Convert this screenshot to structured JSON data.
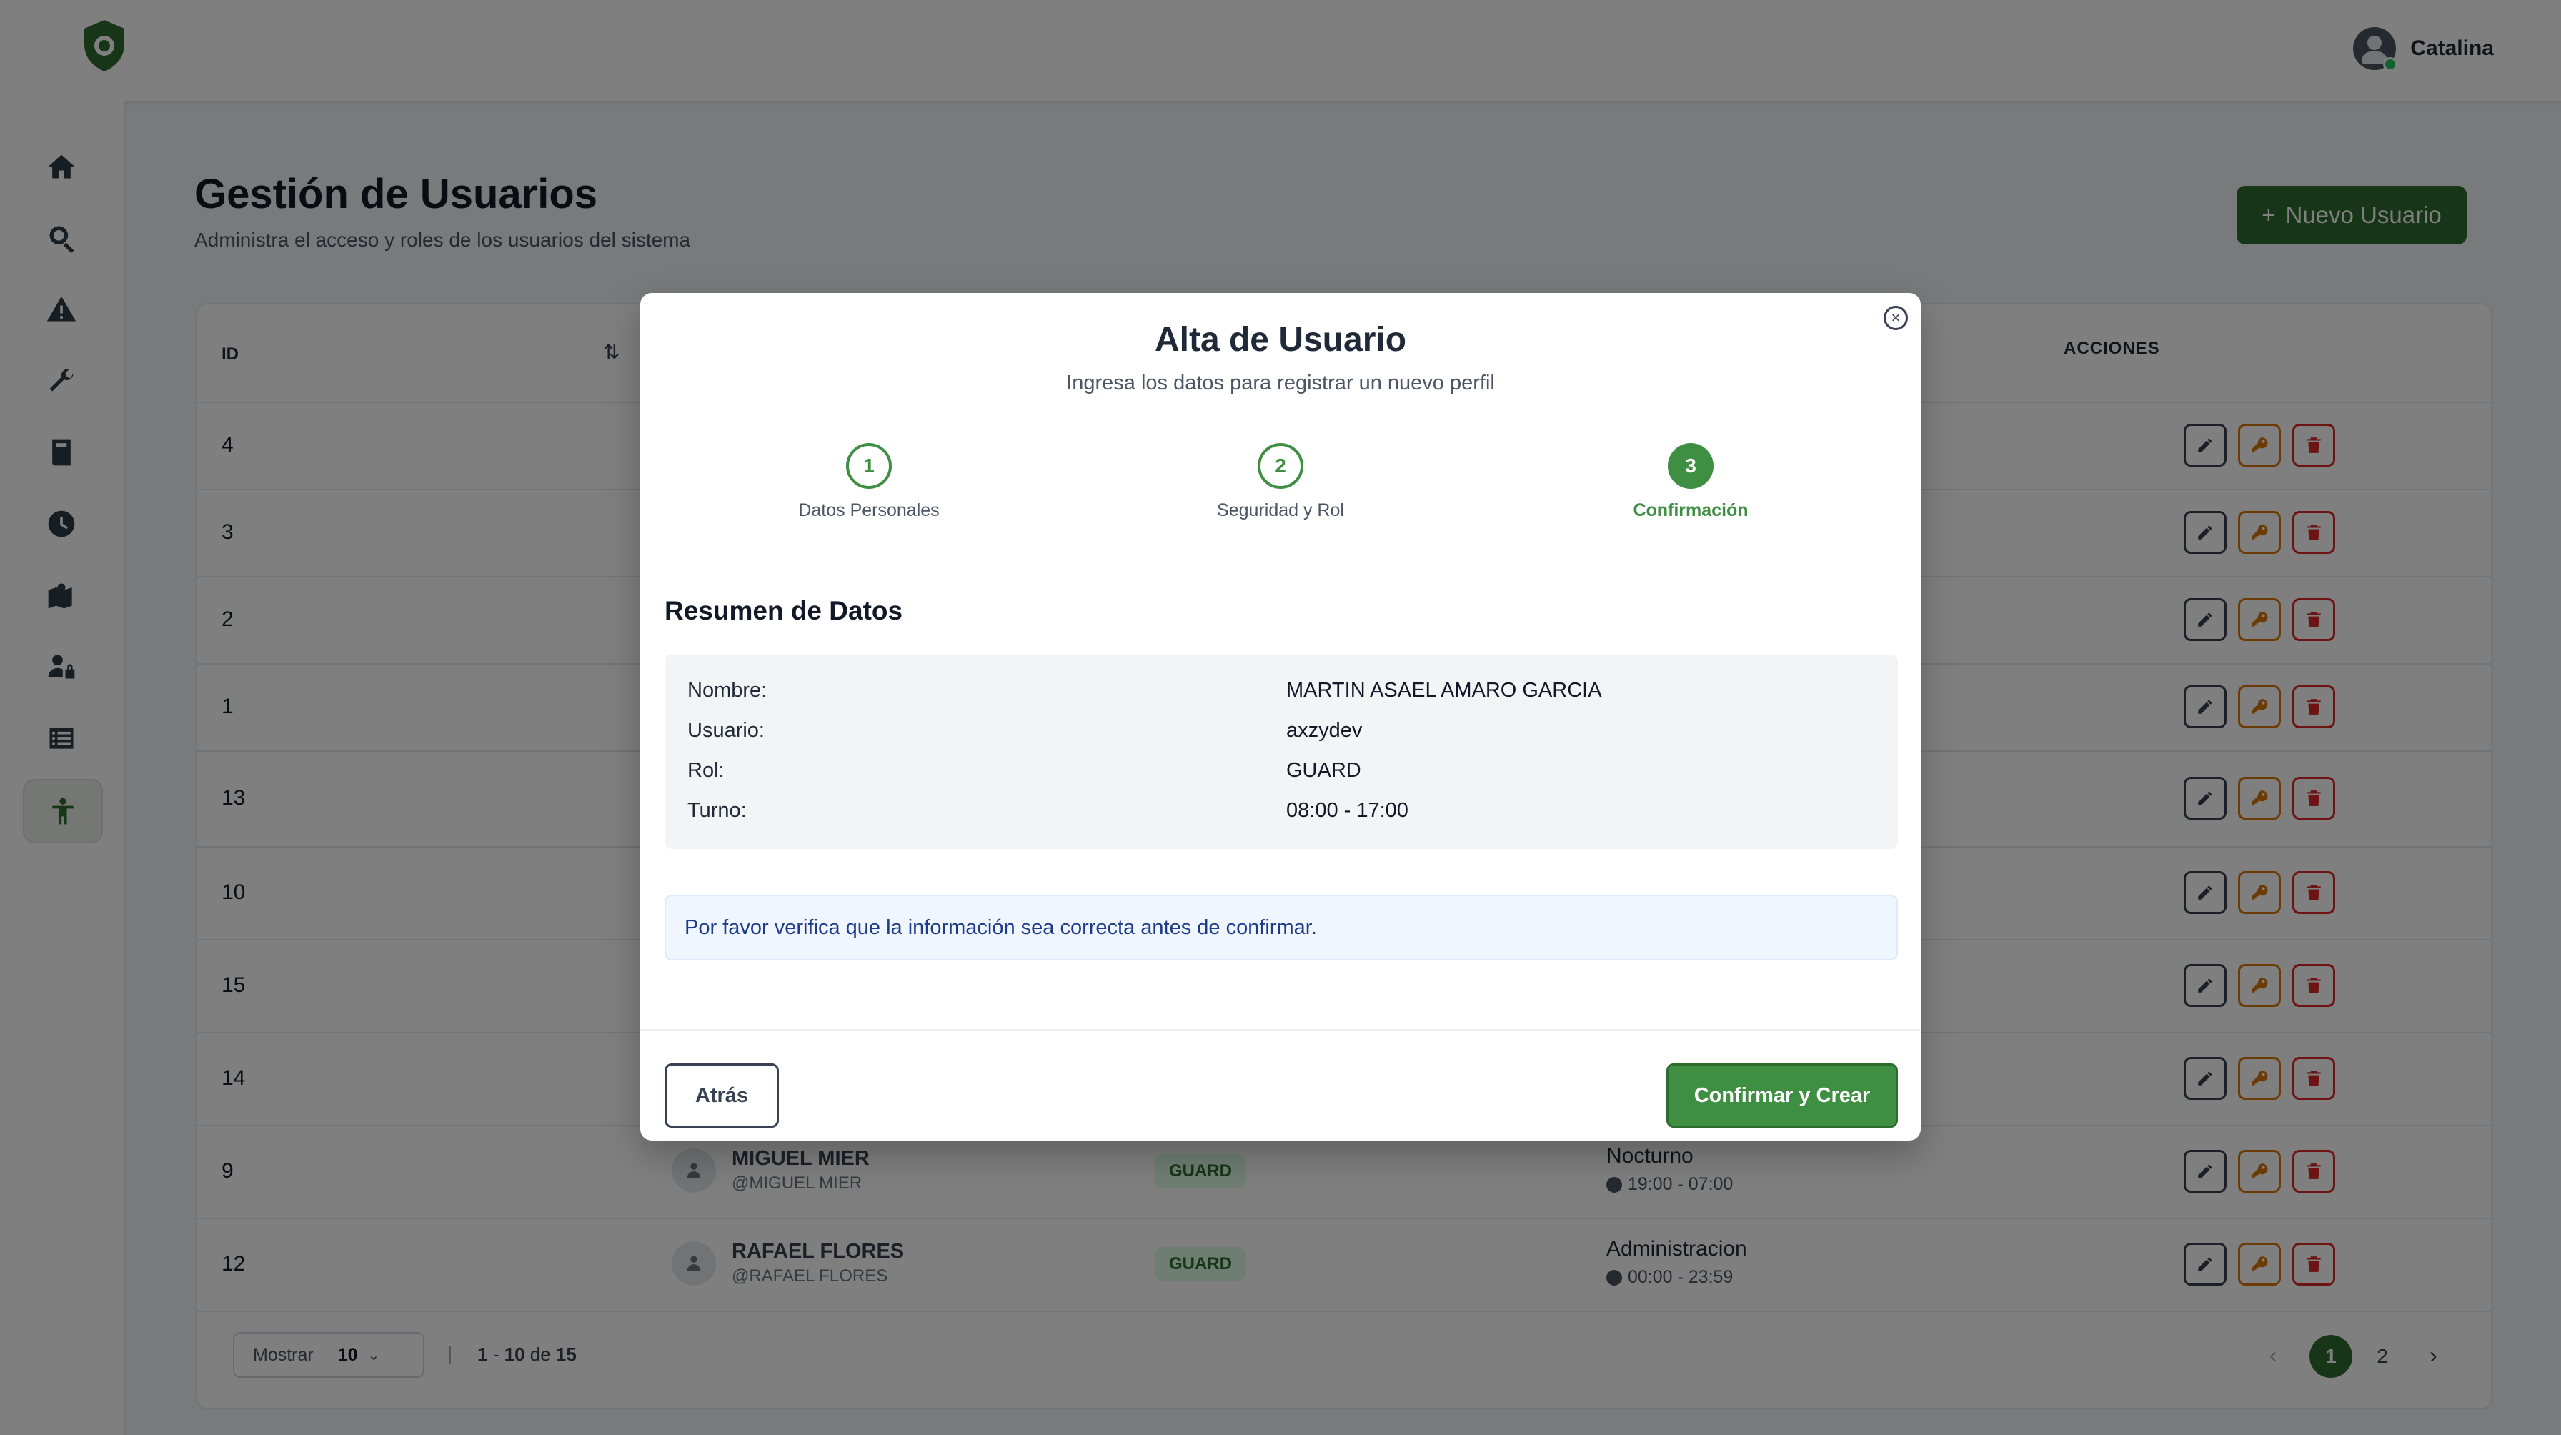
{
  "header": {
    "user_name": "Catalina",
    "logo_icon": "shield-logo-icon"
  },
  "sidebar": {
    "items": [
      {
        "name": "home",
        "icon": "home-icon"
      },
      {
        "name": "search",
        "icon": "search-icon"
      },
      {
        "name": "alerts",
        "icon": "warning-icon"
      },
      {
        "name": "tools",
        "icon": "wrench-icon"
      },
      {
        "name": "book",
        "icon": "book-icon"
      },
      {
        "name": "history",
        "icon": "clock-icon"
      },
      {
        "name": "map",
        "icon": "map-icon"
      },
      {
        "name": "user-lock",
        "icon": "user-lock-icon"
      },
      {
        "name": "list",
        "icon": "list-icon"
      },
      {
        "name": "users",
        "icon": "person-icon",
        "active": true
      }
    ]
  },
  "page": {
    "title": "Gestión de Usuarios",
    "subtitle": "Administra el acceso y roles de los usuarios del sistema",
    "new_button": "Nuevo Usuario",
    "new_button_icon": "+"
  },
  "table": {
    "headers": {
      "id": "ID",
      "sort_icon": "⇅",
      "actions": "ACCIONES"
    },
    "rows": [
      {
        "id": "4"
      },
      {
        "id": "3"
      },
      {
        "id": "2"
      },
      {
        "id": "1"
      },
      {
        "id": "13"
      },
      {
        "id": "10"
      },
      {
        "id": "15"
      },
      {
        "id": "14"
      },
      {
        "id": "9",
        "name": "MIGUEL MIER",
        "username": "@MIGUEL MIER",
        "role": "GUARD",
        "shift": "Nocturno",
        "hours": "19:00 - 07:00"
      },
      {
        "id": "12",
        "name": "RAFAEL FLORES",
        "username": "@RAFAEL FLORES",
        "role": "GUARD",
        "shift": "Administracion",
        "hours": "00:00 - 23:59"
      }
    ]
  },
  "pagination": {
    "show_label": "Mostrar",
    "page_size": "10",
    "separator": "|",
    "range_start": "1",
    "range_dash": "-",
    "range_end": "10",
    "range_of": "de",
    "total": "15",
    "pages": [
      "1",
      "2"
    ],
    "current": "1",
    "prev": "‹",
    "next": "›"
  },
  "modal": {
    "title": "Alta de Usuario",
    "subtitle": "Ingresa los datos para registrar un nuevo perfil",
    "close_icon": "×",
    "steps": [
      {
        "number": "1",
        "label": "Datos Personales"
      },
      {
        "number": "2",
        "label": "Seguridad y Rol"
      },
      {
        "number": "3",
        "label": "Confirmación"
      }
    ],
    "summary_title": "Resumen de Datos",
    "summary": [
      {
        "key": "Nombre:",
        "value": "MARTIN ASAEL AMARO GARCIA"
      },
      {
        "key": "Usuario:",
        "value": "axzydev"
      },
      {
        "key": "Rol:",
        "value": "GUARD"
      },
      {
        "key": "Turno:",
        "value": "08:00 - 17:00"
      }
    ],
    "info": "Por favor verifica que la información sea correcta antes de confirmar.",
    "back_button": "Atrás",
    "confirm_button": "Confirmar y Crear"
  },
  "colors": {
    "brand": "#2e6b2f",
    "accent": "#3f8f43",
    "warning": "#d97706",
    "danger": "#dc2626"
  }
}
